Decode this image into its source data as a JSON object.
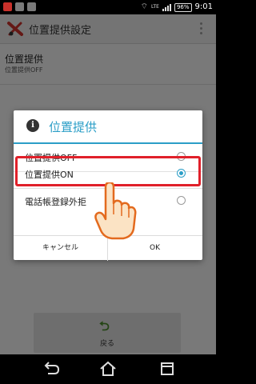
{
  "statusbar": {
    "time": "9:01",
    "battery": "96%",
    "network": "LTE"
  },
  "appbar": {
    "title": "位置提供設定"
  },
  "preference": {
    "title": "位置提供",
    "summary": "位置提供OFF"
  },
  "back_button": {
    "label": "戻る"
  },
  "dialog": {
    "title": "位置提供",
    "options": [
      {
        "label": "位置提供OFF",
        "selected": false
      },
      {
        "label": "位置提供ON",
        "selected": true
      },
      {
        "label": "電話帳登録外拒",
        "selected": false
      }
    ],
    "cancel_label": "キャンセル",
    "ok_label": "OK"
  },
  "colors": {
    "accent": "#2b9ec7",
    "highlight": "#e0202a"
  },
  "icons": [
    "info-icon",
    "back-arrow-icon",
    "home-icon",
    "recent-apps-icon",
    "pointing-hand-icon"
  ]
}
